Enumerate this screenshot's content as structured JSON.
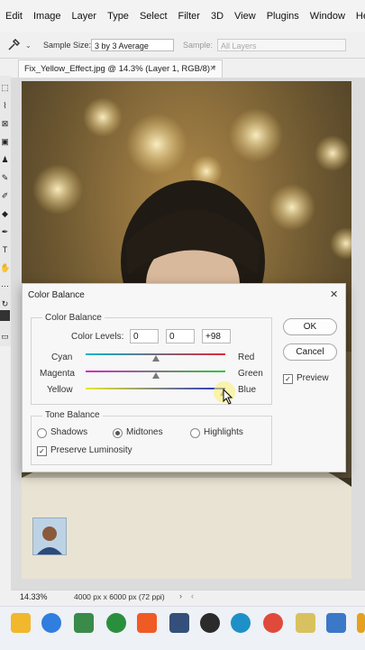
{
  "menu": [
    "Edit",
    "Image",
    "Layer",
    "Type",
    "Select",
    "Filter",
    "3D",
    "View",
    "Plugins",
    "Window",
    "Help"
  ],
  "options_bar": {
    "sample_size_label": "Sample Size:",
    "sample_size_value": "3 by 3 Average",
    "sample_label": "Sample:",
    "sample_value": "All Layers"
  },
  "document": {
    "tab_title": "Fix_Yellow_Effect.jpg @ 14.3% (Layer 1, RGB/8) *",
    "close_glyph": "×"
  },
  "status": {
    "zoom": "14.33%",
    "doc_info": "4000 px x 6000 px (72 ppi)"
  },
  "dialog": {
    "title": "Color Balance",
    "close_glyph": "✕",
    "color_balance_group": "Color Balance",
    "color_levels_label": "Color Levels:",
    "levels": [
      "0",
      "0",
      "+98"
    ],
    "sliders": [
      {
        "left": "Cyan",
        "right": "Red",
        "value": 0
      },
      {
        "left": "Magenta",
        "right": "Green",
        "value": 0
      },
      {
        "left": "Yellow",
        "right": "Blue",
        "value": 98
      }
    ],
    "tone_balance_group": "Tone Balance",
    "tones": [
      {
        "label": "Shadows",
        "selected": false
      },
      {
        "label": "Midtones",
        "selected": true
      },
      {
        "label": "Highlights",
        "selected": false
      }
    ],
    "preserve_luminosity": "Preserve Luminosity",
    "preserve_checked": true,
    "ok": "OK",
    "cancel": "Cancel",
    "preview": "Preview",
    "preview_checked": true
  },
  "colors": {
    "cyan_red": [
      "#00b7c9",
      "#e0263a"
    ],
    "magenta_green": [
      "#d429c9",
      "#2fc83c"
    ],
    "yellow_blue": [
      "#e8e830",
      "#2430c8"
    ]
  }
}
